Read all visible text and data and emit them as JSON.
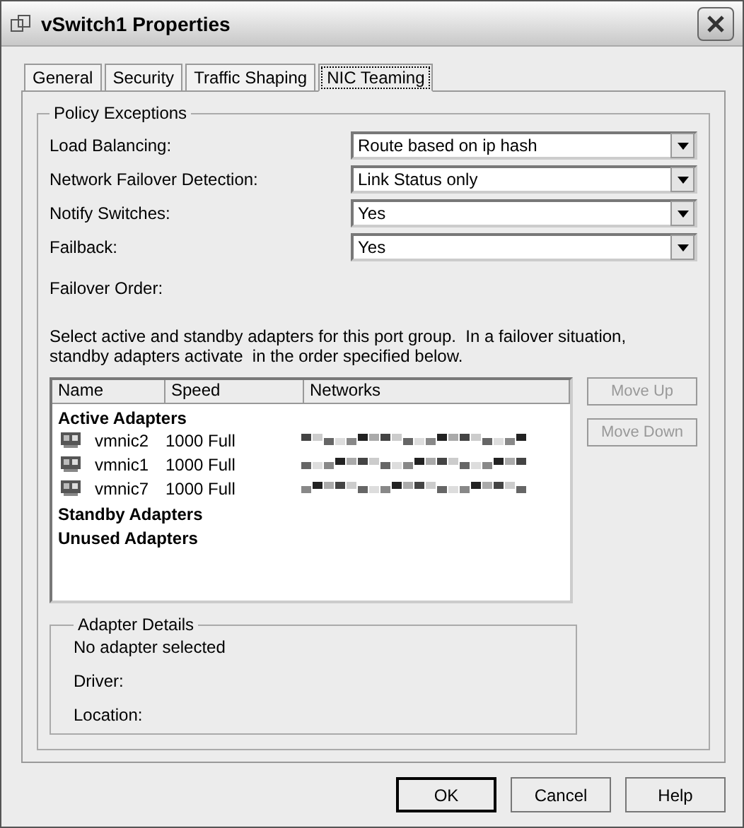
{
  "window": {
    "title": "vSwitch1 Properties"
  },
  "tabs": [
    {
      "label": "General",
      "selected": false
    },
    {
      "label": "Security",
      "selected": false
    },
    {
      "label": "Traffic Shaping",
      "selected": false
    },
    {
      "label": "NIC Teaming",
      "selected": true
    }
  ],
  "policy_exceptions": {
    "title": "Policy Exceptions",
    "settings": [
      {
        "label": "Load Balancing:",
        "value": "Route based on ip hash"
      },
      {
        "label": "Network Failover Detection:",
        "value": "Link Status only"
      },
      {
        "label": "Notify Switches:",
        "value": "Yes"
      },
      {
        "label": "Failback:",
        "value": "Yes"
      }
    ],
    "failover_order_label": "Failover Order:",
    "description": "Select active and standby adapters for this port group.  In a failover situation, standby adapters activate  in the order specified below."
  },
  "adapters_table": {
    "columns": [
      "Name",
      "Speed",
      "Networks"
    ],
    "groups": [
      {
        "title": "Active Adapters",
        "rows": [
          {
            "name": "vmnic2",
            "speed": "1000 Full"
          },
          {
            "name": "vmnic1",
            "speed": "1000 Full"
          },
          {
            "name": "vmnic7",
            "speed": "1000 Full"
          }
        ]
      },
      {
        "title": "Standby Adapters"
      },
      {
        "title": "Unused Adapters"
      }
    ]
  },
  "side_buttons": [
    {
      "label": "Move Up",
      "disabled": true
    },
    {
      "label": "Move Down",
      "disabled": true
    }
  ],
  "adapter_details": {
    "title": "Adapter Details",
    "lines": [
      "No adapter selected",
      "Driver:",
      "Location:"
    ]
  },
  "buttons": [
    {
      "label": "OK",
      "default": true
    },
    {
      "label": "Cancel",
      "default": false
    },
    {
      "label": "Help",
      "default": false
    }
  ]
}
